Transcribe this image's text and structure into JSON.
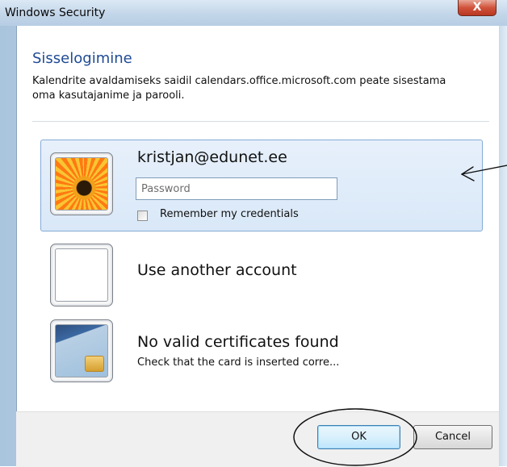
{
  "window": {
    "title": "Windows Security",
    "close_glyph": "X"
  },
  "header": {
    "title": "Sisselogimine",
    "description": "Kalendrite avaldamiseks saidil calendars.office.microsoft.com peate sisestama oma kasutajanime ja parooli."
  },
  "credentials": [
    {
      "name": "kristjan@edunet.ee",
      "password_placeholder": "Password",
      "remember_label": "Remember my credentials",
      "remember_checked": false,
      "selected": true,
      "icon": "flower-avatar-icon"
    },
    {
      "name": "Use another account",
      "icon": "blank-account-icon"
    },
    {
      "name": "No valid certificates found",
      "subtitle": "Check that the card is inserted corre...",
      "icon": "smart-card-icon"
    }
  ],
  "footer": {
    "ok_label": "OK",
    "cancel_label": "Cancel"
  },
  "colors": {
    "header_title": "#1f4a95",
    "selected_tile": "#d9e8f8",
    "close_button": "#d0533b"
  }
}
